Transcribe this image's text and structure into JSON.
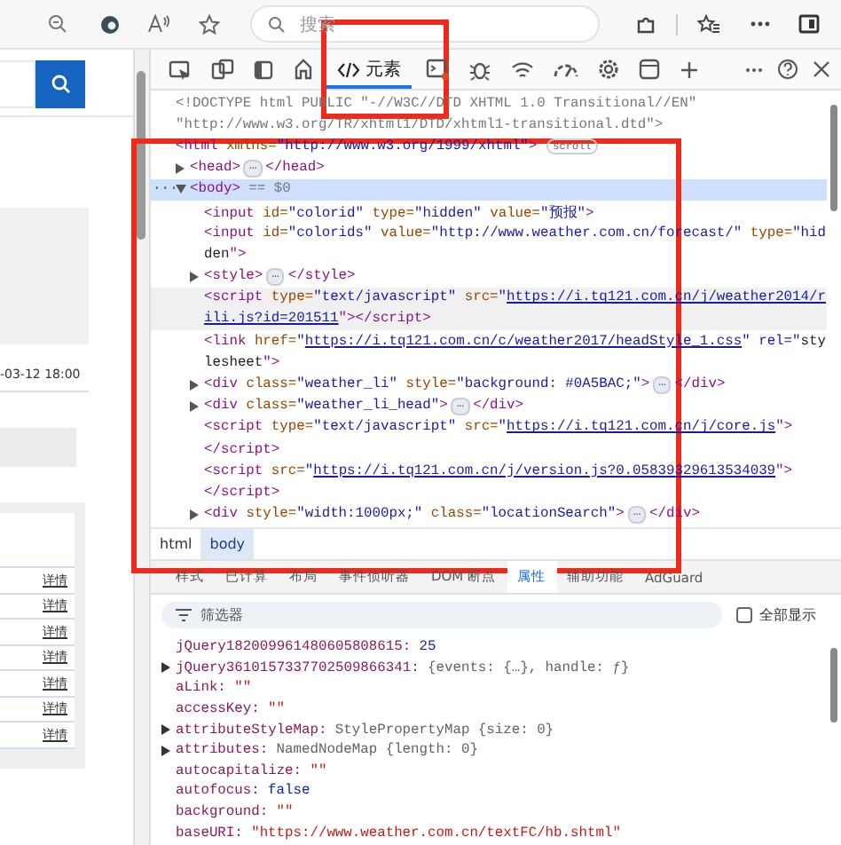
{
  "browser": {
    "address_placeholder": "搜索"
  },
  "page": {
    "date": "-03-12 18:00",
    "detail_links": [
      "详情",
      "详情",
      "详情",
      "详情",
      "详情",
      "详情",
      "详情"
    ]
  },
  "panel_tabs": [
    {
      "selected": false
    },
    {
      "selected": false
    },
    {
      "selected": false
    },
    {
      "selected": false
    },
    {
      "label": "元素",
      "selected": true
    },
    {
      "selected": false
    },
    {
      "selected": false
    },
    {
      "selected": false
    },
    {
      "selected": false
    },
    {
      "selected": false
    },
    {
      "selected": false
    },
    {
      "selected": false
    }
  ],
  "dom_tree": [
    {
      "lines": [
        [
          {
            "kind": "comment",
            "text": "<!DOCTYPE html PUBLIC \"-//W3C//DTD XHTML 1.0 Transitional//EN\""
          }
        ],
        [
          {
            "kind": "comment",
            "text": "\"http://www.w3.org/TR/xhtml1/DTD/xhtml1-transitional.dtd\">"
          }
        ]
      ]
    },
    {
      "lines": [
        [
          {
            "kind": "markup",
            "text": "<html xmlns=\"http://www.w3.org/1999/xhtml\">"
          }
        ]
      ],
      "badge": "scroll",
      "children": [
        {
          "expanded": false,
          "lines": [
            [
              {
                "kind": "markup",
                "text": "<head>"
              },
              {
                "kind": "ellipsis",
                "text": "…"
              },
              {
                "kind": "markup",
                "text": "</head>"
              }
            ]
          ]
        },
        {
          "expanded": true,
          "selected": true,
          "gutter": "···",
          "lines": [
            [
              {
                "kind": "markup",
                "text": "<body>"
              },
              {
                "kind": "comment",
                "text": " == $0"
              }
            ]
          ],
          "children": [
            {
              "lines": [
                [
                  {
                    "kind": "markup",
                    "text": "<input id=\"colorid\" type=\"hidden\" value=\"预报\">"
                  }
                ]
              ]
            },
            {
              "lines": [
                [
                  {
                    "kind": "markup",
                    "text": "<input id=\"colorids\" value=\"http://www.weather.com.cn/forecast/\" type=\"hid"
                  }
                ],
                [
                  {
                    "kind": "markup",
                    "text": "den\">"
                  }
                ]
              ]
            },
            {
              "expanded": false,
              "lines": [
                [
                  {
                    "kind": "markup",
                    "text": "<style>"
                  },
                  {
                    "kind": "ellipsis",
                    "text": "…"
                  },
                  {
                    "kind": "markup",
                    "text": "</style>"
                  }
                ]
              ]
            },
            {
              "hovered": true,
              "lines": [
                [
                  {
                    "kind": "markup",
                    "text": "<script type=\"text/javascript\" src=\""
                  },
                  {
                    "kind": "link",
                    "text": "https://i.tq121.com.cn/j/weather2014/r"
                  }
                ],
                [
                  {
                    "kind": "link",
                    "text": "ili.js?id=201511"
                  },
                  {
                    "kind": "markup",
                    "text": "\"></script>"
                  }
                ]
              ]
            },
            {
              "lines": [
                [
                  {
                    "kind": "markup",
                    "text": "<link href=\""
                  },
                  {
                    "kind": "link",
                    "text": "https://i.tq121.com.cn/c/weather2017/headStyle_1.css"
                  },
                  {
                    "kind": "markup",
                    "text": "\" rel=\"sty"
                  }
                ],
                [
                  {
                    "kind": "markup",
                    "text": "lesheet\">"
                  }
                ]
              ]
            },
            {
              "expanded": false,
              "lines": [
                [
                  {
                    "kind": "markup",
                    "text": "<div class=\"weather_li\" style=\"background: #0A5BAC;\">"
                  },
                  {
                    "kind": "ellipsis",
                    "text": "…"
                  },
                  {
                    "kind": "markup",
                    "text": "</div>"
                  }
                ]
              ]
            },
            {
              "expanded": false,
              "lines": [
                [
                  {
                    "kind": "markup",
                    "text": "<div class=\"weather_li_head\">"
                  },
                  {
                    "kind": "ellipsis",
                    "text": "…"
                  },
                  {
                    "kind": "markup",
                    "text": "</div>"
                  }
                ]
              ]
            },
            {
              "lines": [
                [
                  {
                    "kind": "markup",
                    "text": "<script type=\"text/javascript\" src=\""
                  },
                  {
                    "kind": "link",
                    "text": "https://i.tq121.com.cn/j/core.js"
                  },
                  {
                    "kind": "markup",
                    "text": "\">"
                  }
                ],
                [
                  {
                    "kind": "markup",
                    "text": "</script>"
                  }
                ]
              ]
            },
            {
              "lines": [
                [
                  {
                    "kind": "markup",
                    "text": "<script src=\""
                  },
                  {
                    "kind": "link",
                    "text": "https://i.tq121.com.cn/j/version.js?0.05839329613534039"
                  },
                  {
                    "kind": "markup",
                    "text": "\">"
                  }
                ],
                [
                  {
                    "kind": "markup",
                    "text": "</script>"
                  }
                ]
              ]
            },
            {
              "expanded": false,
              "lines": [
                [
                  {
                    "kind": "markup",
                    "text": "<div style=\"width:1000px;\" class=\"locationSearch\">"
                  },
                  {
                    "kind": "ellipsis",
                    "text": "…"
                  },
                  {
                    "kind": "markup",
                    "text": "</div>"
                  }
                ]
              ]
            }
          ]
        }
      ]
    }
  ],
  "breadcrumbs": [
    {
      "label": "html",
      "selected": false
    },
    {
      "label": "body",
      "selected": true
    }
  ],
  "sub_tabs": [
    {
      "label": "样式",
      "selected": false
    },
    {
      "label": "已计算",
      "selected": false
    },
    {
      "label": "布局",
      "selected": false
    },
    {
      "label": "事件侦听器",
      "selected": false
    },
    {
      "label": "DOM 断点",
      "selected": false
    },
    {
      "label": "属性",
      "selected": true
    },
    {
      "label": "辅助功能",
      "selected": false
    },
    {
      "label": "AdGuard",
      "selected": false
    }
  ],
  "filter": {
    "placeholder": "筛选器",
    "show_all_label": "全部显示",
    "show_all_checked": false
  },
  "properties": [
    {
      "key": "jQuery182009961480605808615:",
      "value": "25",
      "kind": "number",
      "expandable": false
    },
    {
      "key": "jQuery3610157337702509866341:",
      "value": "{events: {…}, handle: ƒ}",
      "kind": "object",
      "expandable": true
    },
    {
      "key": "aLink:",
      "value": "\"\"",
      "kind": "string",
      "expandable": false
    },
    {
      "key": "accessKey:",
      "value": "\"\"",
      "kind": "string",
      "expandable": false
    },
    {
      "key": "attributeStyleMap:",
      "value": "StylePropertyMap {size: 0}",
      "kind": "object",
      "expandable": true
    },
    {
      "key": "attributes:",
      "value": "NamedNodeMap {length: 0}",
      "kind": "object",
      "expandable": true
    },
    {
      "key": "autocapitalize:",
      "value": "\"\"",
      "kind": "string",
      "expandable": false
    },
    {
      "key": "autofocus:",
      "value": "false",
      "kind": "boolean",
      "expandable": false
    },
    {
      "key": "background:",
      "value": "\"\"",
      "kind": "string",
      "expandable": false
    },
    {
      "key": "baseURI:",
      "value": "\"https://www.weather.com.cn/textFC/hb.shtml\"",
      "kind": "string",
      "expandable": false
    }
  ],
  "annotations": [
    {
      "kind": "frame"
    },
    {
      "kind": "frame"
    }
  ]
}
